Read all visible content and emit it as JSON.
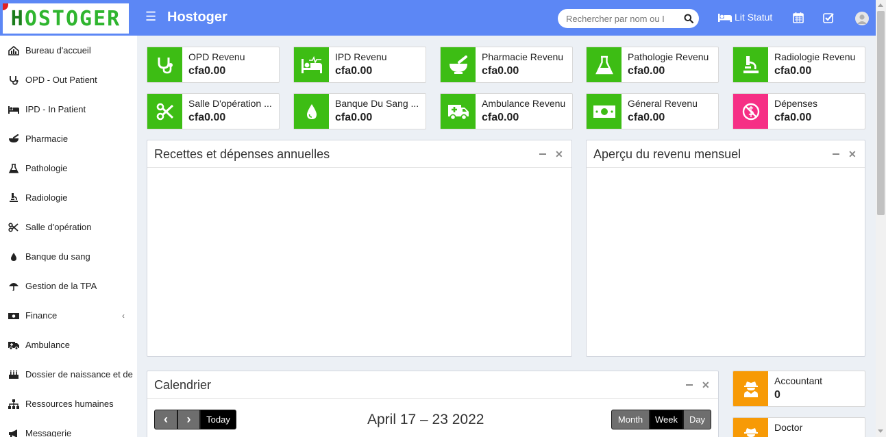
{
  "header": {
    "logo_text_first": "H",
    "logo_text_rest": "OSTOGER",
    "app_title": "Hostoger",
    "search_placeholder": "Rechercher par nom ou I",
    "bed_status_label": "Lit Statut"
  },
  "sidebar": {
    "items": [
      {
        "label": "Bureau d'accueil",
        "icon": "dashboard-icon"
      },
      {
        "label": "OPD - Out Patient",
        "icon": "stethoscope-icon"
      },
      {
        "label": "IPD - In Patient",
        "icon": "bed-icon"
      },
      {
        "label": "Pharmacie",
        "icon": "mortar-pestle-icon"
      },
      {
        "label": "Pathologie",
        "icon": "flask-icon"
      },
      {
        "label": "Radiologie",
        "icon": "microscope-icon"
      },
      {
        "label": "Salle d'opération",
        "icon": "scissors-icon"
      },
      {
        "label": "Banque du sang",
        "icon": "drop-icon"
      },
      {
        "label": "Gestion de la TPA",
        "icon": "umbrella-icon"
      },
      {
        "label": "Finance",
        "icon": "money-icon"
      },
      {
        "label": "Ambulance",
        "icon": "ambulance-icon"
      },
      {
        "label": "Dossier de naissance et de",
        "icon": "birthday-cake-icon"
      },
      {
        "label": "Ressources humaines",
        "icon": "sitemap-icon"
      },
      {
        "label": "Messagerie",
        "icon": "bullhorn-icon"
      }
    ],
    "finance_chevron": "‹"
  },
  "stats": [
    {
      "label": "OPD Revenu",
      "value": "cfa0.00",
      "icon": "stethoscope-icon"
    },
    {
      "label": "IPD Revenu",
      "value": "cfa0.00",
      "icon": "bed-icon"
    },
    {
      "label": "Pharmacie Revenu",
      "value": "cfa0.00",
      "icon": "mortar-pestle-icon"
    },
    {
      "label": "Pathologie Revenu",
      "value": "cfa0.00",
      "icon": "flask-icon"
    },
    {
      "label": "Radiologie Revenu",
      "value": "cfa0.00",
      "icon": "microscope-icon"
    },
    {
      "label": "Salle D'opération ...",
      "value": "cfa0.00",
      "icon": "scissors-icon"
    },
    {
      "label": "Banque Du Sang ...",
      "value": "cfa0.00",
      "icon": "drop-icon"
    },
    {
      "label": "Ambulance Revenu",
      "value": "cfa0.00",
      "icon": "ambulance-icon"
    },
    {
      "label": "Géneral Revenu",
      "value": "cfa0.00",
      "icon": "money-icon"
    },
    {
      "label": "Dépenses",
      "value": "cfa0.00",
      "icon": "no-money-icon"
    }
  ],
  "panels": {
    "annual": "Recettes et dépenses annuelles",
    "monthly": "Aperçu du revenu mensuel",
    "calendar": "Calendrier"
  },
  "calendar": {
    "prev": "‹",
    "next": "›",
    "today": "Today",
    "range": "April 17 – 23 2022",
    "views": [
      "Month",
      "Week",
      "Day"
    ],
    "active_view": "Week"
  },
  "staff": [
    {
      "label": "Accountant",
      "value": "0"
    },
    {
      "label": "Doctor",
      "value": ""
    }
  ],
  "colors": {
    "header": "#5c87f5",
    "stat_green": "#3dbd14",
    "stat_pink": "#f62f85",
    "staff_orange": "#f79a06"
  }
}
